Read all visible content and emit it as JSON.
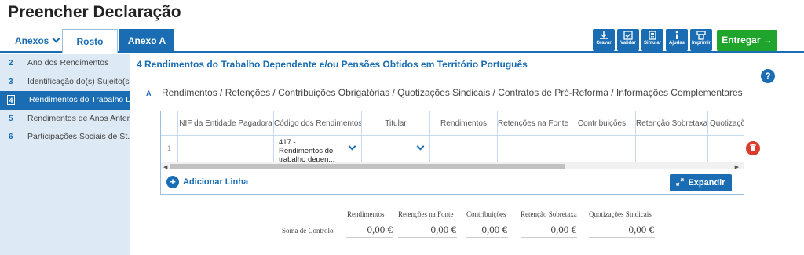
{
  "page": {
    "title": "Preencher Declaração"
  },
  "tabs": {
    "anexos": "Anexos",
    "rosto": "Rosto",
    "anexo_a": "Anexo A"
  },
  "toolbar": [
    {
      "label": "Gravar",
      "icon": "download-icon"
    },
    {
      "label": "Validar",
      "icon": "checkbox-icon"
    },
    {
      "label": "Simular",
      "icon": "calculator-icon"
    },
    {
      "label": "Ajudas",
      "icon": "info-icon"
    },
    {
      "label": "Imprimir",
      "icon": "printer-icon"
    }
  ],
  "submit": {
    "label": "Entregar →"
  },
  "sidebar": {
    "items": [
      {
        "num": "2",
        "label": "Ano dos Rendimentos"
      },
      {
        "num": "3",
        "label": "Identificação do(s) Sujeito(s..."
      },
      {
        "num": "4",
        "label": "Rendimentos do Trabalho D..."
      },
      {
        "num": "5",
        "label": "Rendimentos de Anos Anter..."
      },
      {
        "num": "6",
        "label": "Participações Sociais de St..."
      }
    ]
  },
  "section": {
    "title": "4  Rendimentos do Trabalho Dependente e/ou Pensões Obtidos em Território Português",
    "help": "?",
    "sub_letter": "A",
    "sub_title": "Rendimentos / Retenções / Contribuições Obrigatórias / Quotizações Sindicais / Contratos de Pré-Reforma / Informações Complementares"
  },
  "table": {
    "headers": [
      "NIF da Entidade Pagadora",
      "Código dos Rendimentos",
      "Titular",
      "Rendimentos",
      "Retenções na Fonte",
      "Contribuições",
      "Retenção Sobretaxa",
      "Quotizações"
    ],
    "row": {
      "num": "1",
      "nif": "",
      "codigo": "417 - Rendimentos do trabalho depen...",
      "titular": "",
      "rendimentos": "",
      "retencoes": "",
      "contribuicoes": "",
      "sobretaxa": "",
      "quotizacoes": ""
    }
  },
  "actions": {
    "add_line": "Adicionar Linha",
    "expand": "Expandir"
  },
  "totals": {
    "label": "Soma de Controlo",
    "headers": [
      "Rendimentos",
      "Retenções na Fonte",
      "Contribuições",
      "Retenção Sobretaxa",
      "Quotizações Sindicais"
    ],
    "values": [
      "0,00 €",
      "0,00 €",
      "0,00 €",
      "0,00 €",
      "0,00 €"
    ]
  },
  "colors": {
    "primary": "#1a6db3",
    "success": "#1fa52b",
    "danger": "#d93b2d",
    "sidebar_bg": "#dde9f5"
  }
}
